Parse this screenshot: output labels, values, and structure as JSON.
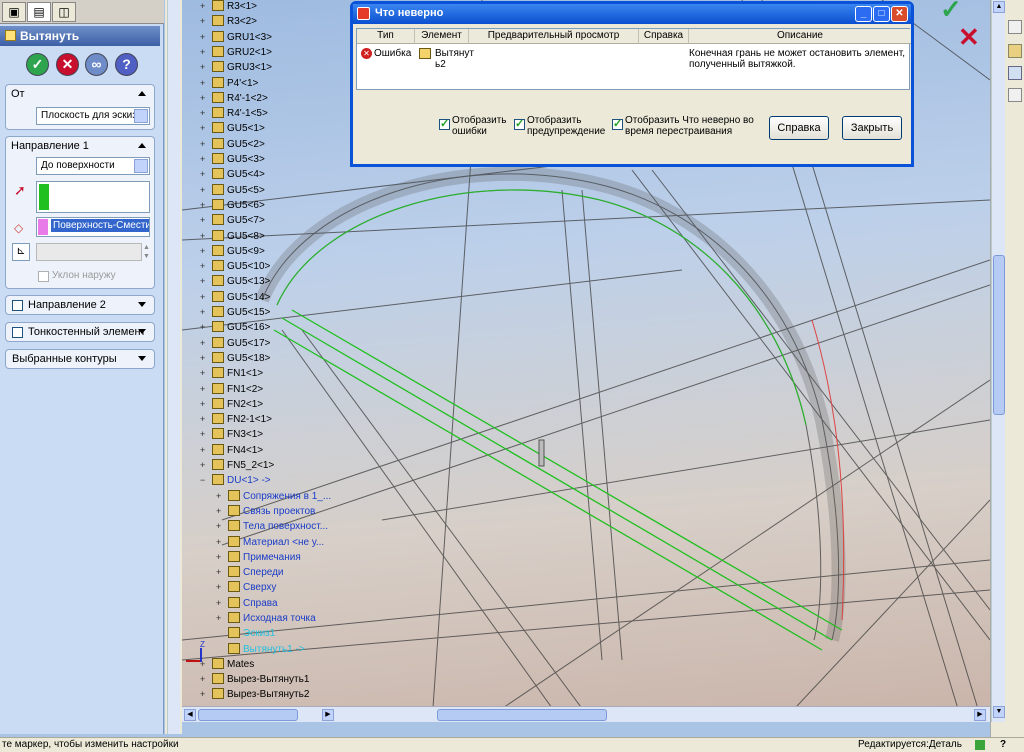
{
  "property_manager": {
    "title": "Вытянуть",
    "from_group": {
      "title": "От",
      "value": "Плоскость для эскиза"
    },
    "direction1": {
      "title": "Направление 1",
      "end_condition": "До поверхности",
      "surface_value": "Поверхность-Сместить",
      "draft_label": "Уклон наружу"
    },
    "direction2_label": "Направление 2",
    "thin_label": "Тонкостенный элемент",
    "contours_label": "Выбранные контуры"
  },
  "tree": {
    "items": [
      "R3<1>",
      "R3<2>",
      "GRU1<3>",
      "GRU2<1>",
      "GRU3<1>",
      "P4'<1>",
      "R4'-1<2>",
      "R4'-1<5>",
      "GU5<1>",
      "GU5<2>",
      "GU5<3>",
      "GU5<4>",
      "GU5<5>",
      "GU5<6>",
      "GU5<7>",
      "GU5<8>",
      "GU5<9>",
      "GU5<10>",
      "GU5<13>",
      "GU5<14>",
      "GU5<15>",
      "GU5<16>",
      "GU5<17>",
      "GU5<18>",
      "FN1<1>",
      "FN1<2>",
      "FN2<1>",
      "FN2-1<1>",
      "FN3<1>",
      "FN4<1>",
      "FN5_2<1>"
    ],
    "sub_assembly": "DU<1> ->",
    "sub_items": [
      "Сопряжения в 1_...",
      "Связь проектов",
      "Тела поверхност...",
      "Материал <не у...",
      "Примечания",
      "Спереди",
      "Сверху",
      "Справа",
      "Исходная точка"
    ],
    "cyan_items": [
      "Эскиз1",
      "Вытянуть1 ->"
    ],
    "bottom_items": [
      "Mates",
      "Вырез-Вытянуть1",
      "Вырез-Вытянуть2"
    ]
  },
  "dialog": {
    "title": "Что неверно",
    "columns": [
      "Тип",
      "Элемент",
      "Предварительный просмотр",
      "Справка",
      "Описание"
    ],
    "row": {
      "type": "Ошибка",
      "element_line1": "Вытянут",
      "element_line2": "ь2",
      "description_line1": "Конечная грань не может остановить элемент,",
      "description_line2": "полученный вытяжкой."
    },
    "checks": [
      {
        "line1": "Отобразить",
        "line2": "ошибки",
        "checked": true
      },
      {
        "line1": "Отобразить",
        "line2": "предупреждение",
        "checked": true
      },
      {
        "line1": "Отобразить Что неверно во",
        "line2": "время перестраивания",
        "checked": true
      }
    ],
    "help_button": "Справка",
    "close_button": "Закрыть"
  },
  "status": {
    "hint": "те маркер, чтобы изменить настройки",
    "editing": "Редактируется:Деталь"
  },
  "colors": {
    "accent": "#0a4fd0",
    "accept_green": "#2ea44f",
    "cancel_red": "#c8102e",
    "highlight_green": "#20c020"
  }
}
